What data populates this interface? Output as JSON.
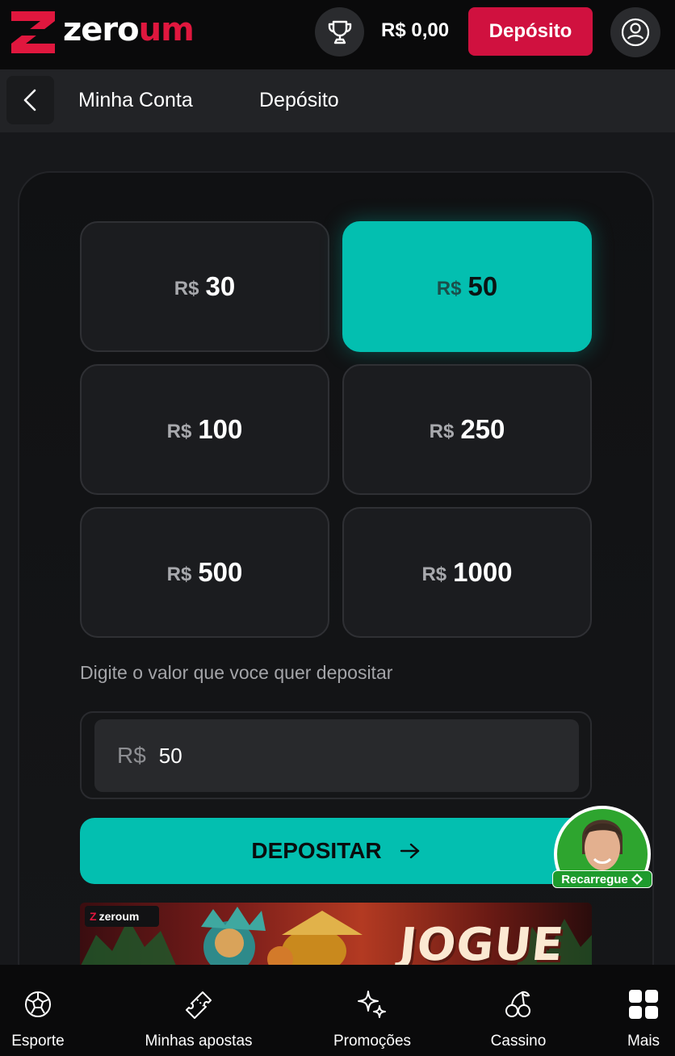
{
  "header": {
    "logo_zero": "zero",
    "logo_um": "um",
    "balance": "R$ 0,00",
    "deposit_label": "Depósito",
    "colors": {
      "accent": "#d0113f",
      "brand_red": "#e0173e"
    }
  },
  "breadcrumb": {
    "items": [
      {
        "label": "Minha Conta"
      },
      {
        "label": "Depósito"
      }
    ]
  },
  "deposit": {
    "currency": "R$",
    "amounts": [
      {
        "value": "30",
        "selected": false
      },
      {
        "value": "50",
        "selected": true
      },
      {
        "value": "100",
        "selected": false
      },
      {
        "value": "250",
        "selected": false
      },
      {
        "value": "500",
        "selected": false
      },
      {
        "value": "1000",
        "selected": false
      }
    ],
    "prompt": "Digite o valor que voce quer depositar",
    "input_prefix": "R$",
    "input_value": "50",
    "submit_label": "DEPOSITAR",
    "accent_color": "#03bfb0"
  },
  "banner": {
    "logo_text": "zeroum",
    "title": "JOGUE"
  },
  "recarregue": {
    "label": "Recarregue"
  },
  "bottom_nav": {
    "items": [
      {
        "label": "Esporte",
        "icon": "soccer-ball-icon"
      },
      {
        "label": "Minhas apostas",
        "icon": "ticket-icon"
      },
      {
        "label": "Promoções",
        "icon": "sparkles-icon"
      },
      {
        "label": "Cassino",
        "icon": "cherries-icon"
      },
      {
        "label": "Mais",
        "icon": "grid-icon"
      }
    ]
  }
}
